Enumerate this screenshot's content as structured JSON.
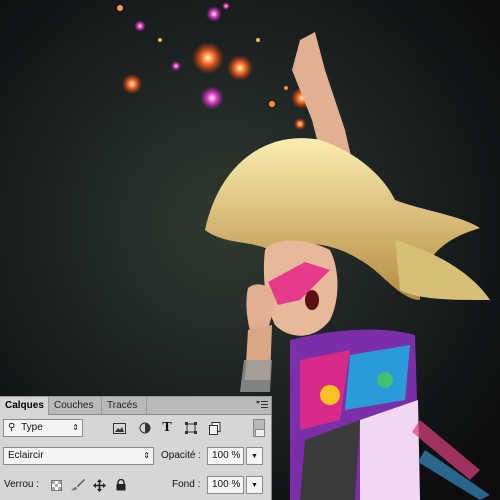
{
  "layers_panel": {
    "tabs": [
      {
        "label": "Calques",
        "active": true
      },
      {
        "label": "Couches",
        "active": false
      },
      {
        "label": "Tracés",
        "active": false
      }
    ],
    "filter_kind": "Type",
    "filter_icons": [
      "image-icon",
      "adjustment-icon",
      "text-icon",
      "shape-icon",
      "smart-object-icon"
    ],
    "blend_mode": "Eclaircir",
    "opacity_label": "Opacité :",
    "opacity_value": "100 %",
    "lock_label": "Verrou :",
    "lock_icons": [
      "lock-transparency-icon",
      "lock-brush-icon",
      "lock-move-icon",
      "lock-all-icon"
    ],
    "fill_label": "Fond :",
    "fill_value": "100 %"
  },
  "colors": {
    "panel_bg": "#d6d6d6",
    "photo_bg": "#1c2222",
    "glasses": "#e63a8a",
    "hair": "#e8cf7e"
  }
}
